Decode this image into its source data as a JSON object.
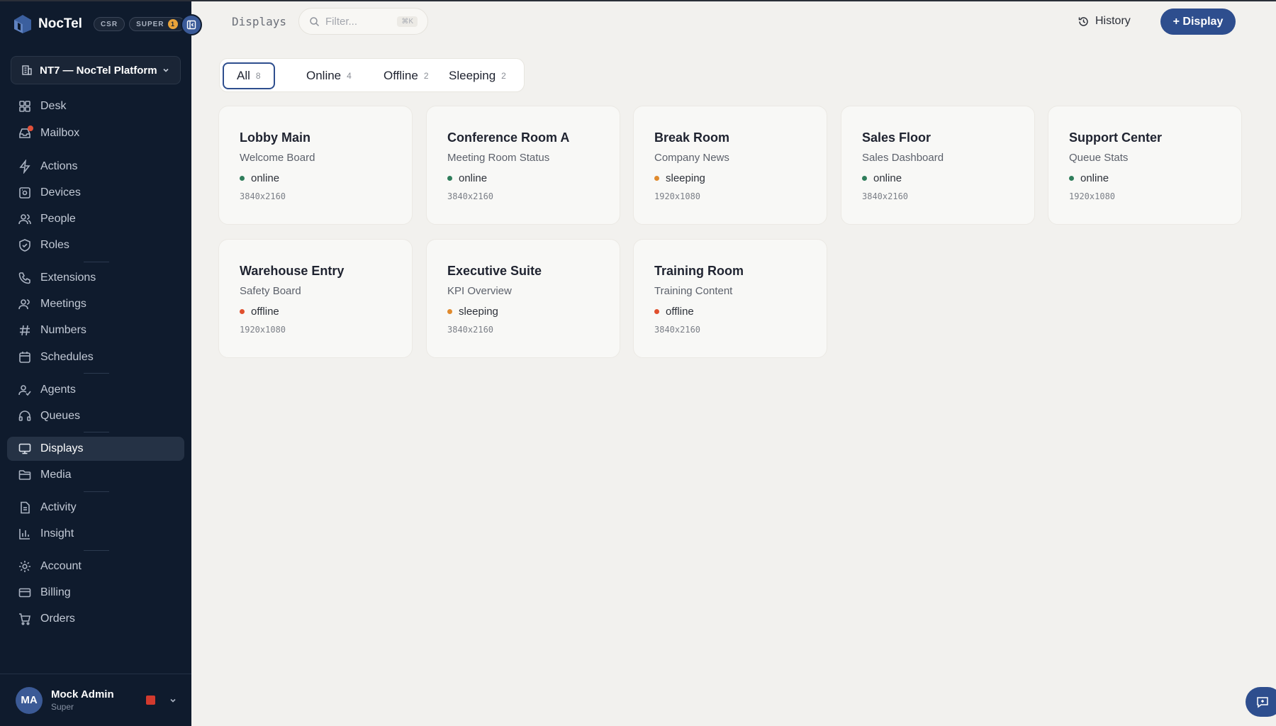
{
  "brand": {
    "name": "NocTel",
    "badge_csr": "CSR",
    "badge_super": "SUPER",
    "badge_super_count": "1"
  },
  "org": {
    "label": "NT7 — NocTel Platform"
  },
  "nav": [
    {
      "id": "desk",
      "label": "Desk",
      "icon": "grid-icon"
    },
    {
      "id": "mailbox",
      "label": "Mailbox",
      "icon": "inbox-icon"
    },
    {
      "id": "actions",
      "label": "Actions",
      "icon": "bolt-icon"
    },
    {
      "id": "devices",
      "label": "Devices",
      "icon": "device-icon"
    },
    {
      "id": "people",
      "label": "People",
      "icon": "people-icon"
    },
    {
      "id": "roles",
      "label": "Roles",
      "icon": "shield-icon"
    },
    {
      "id": "extensions",
      "label": "Extensions",
      "icon": "phone-icon"
    },
    {
      "id": "meetings",
      "label": "Meetings",
      "icon": "users-icon"
    },
    {
      "id": "numbers",
      "label": "Numbers",
      "icon": "hash-icon"
    },
    {
      "id": "schedules",
      "label": "Schedules",
      "icon": "calendar-icon"
    },
    {
      "id": "agents",
      "label": "Agents",
      "icon": "agent-icon"
    },
    {
      "id": "queues",
      "label": "Queues",
      "icon": "headset-icon"
    },
    {
      "id": "displays",
      "label": "Displays",
      "icon": "monitor-icon"
    },
    {
      "id": "media",
      "label": "Media",
      "icon": "folder-icon"
    },
    {
      "id": "activity",
      "label": "Activity",
      "icon": "file-icon"
    },
    {
      "id": "insight",
      "label": "Insight",
      "icon": "bar-chart-icon"
    },
    {
      "id": "account",
      "label": "Account",
      "icon": "gear-icon"
    },
    {
      "id": "billing",
      "label": "Billing",
      "icon": "card-icon"
    },
    {
      "id": "orders",
      "label": "Orders",
      "icon": "cart-icon"
    }
  ],
  "user": {
    "initials": "MA",
    "name": "Mock Admin",
    "role": "Super"
  },
  "header": {
    "title": "Displays",
    "filter_placeholder": "Filter...",
    "shortcut": "⌘K",
    "history_label": "History",
    "add_label": "+ Display"
  },
  "tabs": [
    {
      "label": "All",
      "count": "8"
    },
    {
      "label": "Online",
      "count": "4"
    },
    {
      "label": "Offline",
      "count": "2"
    },
    {
      "label": "Sleeping",
      "count": "2"
    }
  ],
  "status_colors": {
    "online": "#2f7d5b",
    "offline": "#e0502e",
    "sleeping": "#e08a2e"
  },
  "displays": [
    {
      "name": "Lobby Main",
      "content": "Welcome Board",
      "status": "online",
      "resolution": "3840x2160"
    },
    {
      "name": "Conference Room A",
      "content": "Meeting Room Status",
      "status": "online",
      "resolution": "3840x2160"
    },
    {
      "name": "Break Room",
      "content": "Company News",
      "status": "sleeping",
      "resolution": "1920x1080"
    },
    {
      "name": "Sales Floor",
      "content": "Sales Dashboard",
      "status": "online",
      "resolution": "3840x2160"
    },
    {
      "name": "Support Center",
      "content": "Queue Stats",
      "status": "online",
      "resolution": "1920x1080"
    },
    {
      "name": "Warehouse Entry",
      "content": "Safety Board",
      "status": "offline",
      "resolution": "1920x1080"
    },
    {
      "name": "Executive Suite",
      "content": "KPI Overview",
      "status": "sleeping",
      "resolution": "3840x2160"
    },
    {
      "name": "Training Room",
      "content": "Training Content",
      "status": "offline",
      "resolution": "3840x2160"
    }
  ]
}
